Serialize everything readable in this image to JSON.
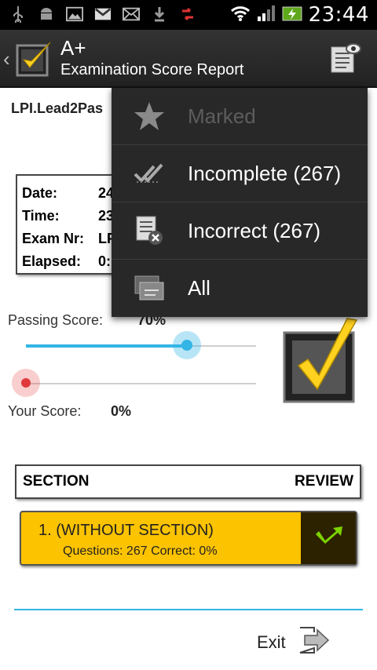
{
  "status_bar": {
    "time": "23:44",
    "icons": [
      "usb-icon",
      "android-icon",
      "image-icon",
      "gmail-icon",
      "mail-icon",
      "download-icon",
      "sync-icon",
      "wifi-icon",
      "signal-icon",
      "battery-icon"
    ]
  },
  "action_bar": {
    "app_title": "A+",
    "subtitle": "Examination Score Report",
    "icons": [
      "back-icon",
      "app-logo-check-icon",
      "review-menu-icon"
    ]
  },
  "exam": {
    "name": "LPI.Lead2Pas",
    "info": [
      {
        "label": "Date:",
        "value": "24"
      },
      {
        "label": "Time:",
        "value": "23"
      },
      {
        "label": "Exam Nr:",
        "value": "LP"
      },
      {
        "label": "Elapsed:",
        "value": "0:"
      }
    ]
  },
  "scores": {
    "passing_label": "Passing Score:",
    "passing_value": "70%",
    "passing_fraction": 0.7,
    "your_label": "Your Score:",
    "your_value": "0%",
    "your_fraction": 0.0
  },
  "section_table": {
    "header_left": "SECTION",
    "header_right": "REVIEW",
    "rows": [
      {
        "title": "1.  (WITHOUT SECTION)",
        "meta": "Questions:  267   Correct:  0%"
      }
    ]
  },
  "footer": {
    "exit_label": "Exit"
  },
  "menu": {
    "items": [
      {
        "label": "Marked",
        "icon": "star-icon",
        "enabled": false
      },
      {
        "label": "Incomplete (267)",
        "icon": "double-check-icon",
        "enabled": true
      },
      {
        "label": "Incorrect (267)",
        "icon": "list-x-icon",
        "enabled": true
      },
      {
        "label": "All",
        "icon": "all-questions-icon",
        "enabled": true
      }
    ]
  },
  "colors": {
    "accent_blue": "#33b5e5",
    "section_yellow": "#fcc300",
    "menu_bg": "#282828",
    "score_red": "#e0393b"
  }
}
